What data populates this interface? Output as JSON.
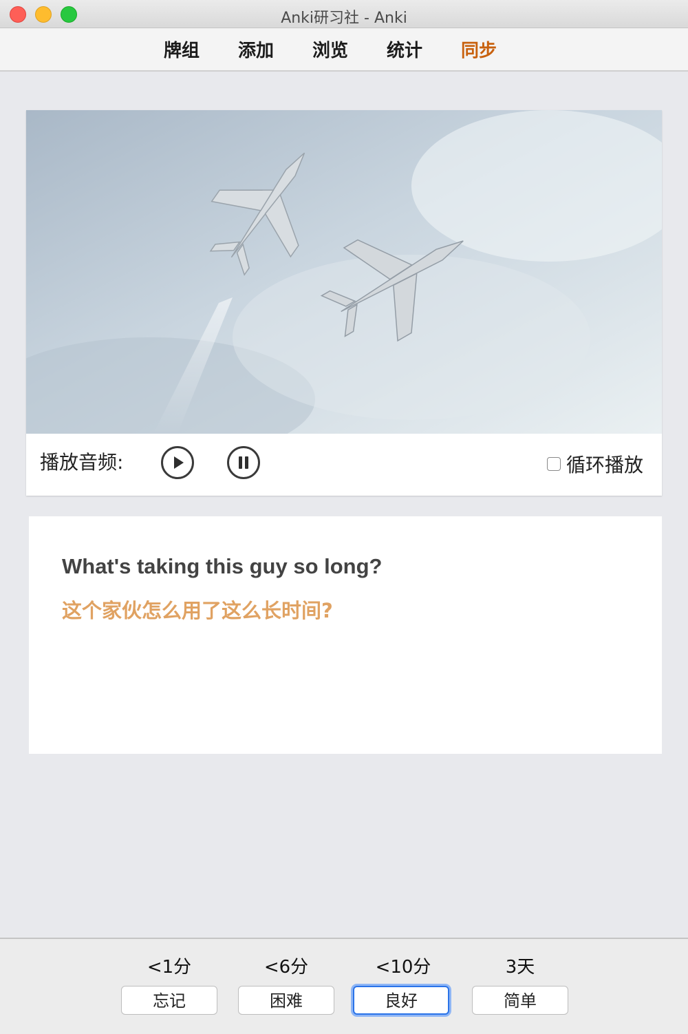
{
  "window": {
    "title": "Anki研习社 - Anki"
  },
  "nav": {
    "items": [
      {
        "label": "牌组"
      },
      {
        "label": "添加"
      },
      {
        "label": "浏览"
      },
      {
        "label": "统计"
      },
      {
        "label": "同步"
      }
    ],
    "active": "同步"
  },
  "media": {
    "audio_label": "播放音频:",
    "play_icon": "play-icon",
    "pause_icon": "pause-icon",
    "loop_label": "循环播放",
    "loop_checked": false
  },
  "card": {
    "english": "What's taking this guy so long?",
    "chinese": "这个家伙怎么用了这么长时间?"
  },
  "answers": [
    {
      "interval": "<1分",
      "label": "忘记"
    },
    {
      "interval": "<6分",
      "label": "困难"
    },
    {
      "interval": "<10分",
      "label": "良好",
      "focused": true
    },
    {
      "interval": "3天",
      "label": "简单"
    }
  ],
  "colors": {
    "active_nav": "#c8610e",
    "chinese_text": "#e0a262",
    "focus_ring": "#2a73e8"
  }
}
